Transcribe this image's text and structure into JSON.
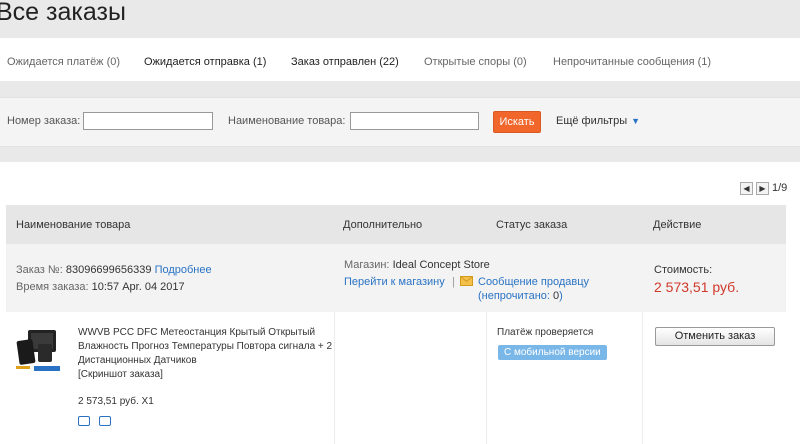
{
  "page": {
    "title": "Все заказы"
  },
  "tabs": [
    {
      "label": "Ожидается платёж (0)"
    },
    {
      "label": "Ожидается отправка (1)"
    },
    {
      "label": "Заказ отправлен (22)"
    },
    {
      "label": "Открытые споры (0)"
    },
    {
      "label": "Непрочитанные сообщения (1)"
    }
  ],
  "search": {
    "order_label": "Номер заказа:",
    "order_value": "",
    "product_label": "Наименование товара:",
    "product_value": "",
    "button": "Искать",
    "more_filters": "Ещё фильтры"
  },
  "pagination": {
    "page": "1/9"
  },
  "table": {
    "headers": [
      "Наименование товара",
      "Дополнительно",
      "Статус заказа",
      "Действие"
    ]
  },
  "order": {
    "number_label": "Заказ №:",
    "number": "83096699656339",
    "details_link": "Подробнее",
    "time_label": "Время заказа:",
    "time": "10:57 Apr. 04 2017",
    "store_label": "Магазин:",
    "store": "Ideal Concept Store",
    "go_to_store": "Перейти к магазину",
    "separator": "|",
    "message_seller": "Сообщение продавцу",
    "unread_prefix": "(непрочитано: ",
    "unread_count": "0",
    "unread_suffix": ")",
    "cost_label": "Стоимость:",
    "cost": "2 573,51 руб."
  },
  "item": {
    "title": "WWVB PCC DFC Метеостанция Крытый Открытый Влажность Прогноз Температуры Повтора сигнала + 2 Дистанционных Датчиков",
    "screenshot": "[Скриншот заказа]",
    "price_qty": "2 573,51 руб. X1",
    "status": "Платёж проверяется",
    "mobile_badge": "С мобильной версии",
    "cancel_button": "Отменить заказ"
  },
  "colors": {
    "accent": "#f1662a",
    "link": "#2a73c4",
    "price": "#d0392b",
    "badge": "#7ab7e9"
  },
  "icons": [
    "prev-page-icon",
    "next-page-icon",
    "chevron-down-icon",
    "envelope-icon",
    "shipping-icon",
    "receipt-icon"
  ]
}
